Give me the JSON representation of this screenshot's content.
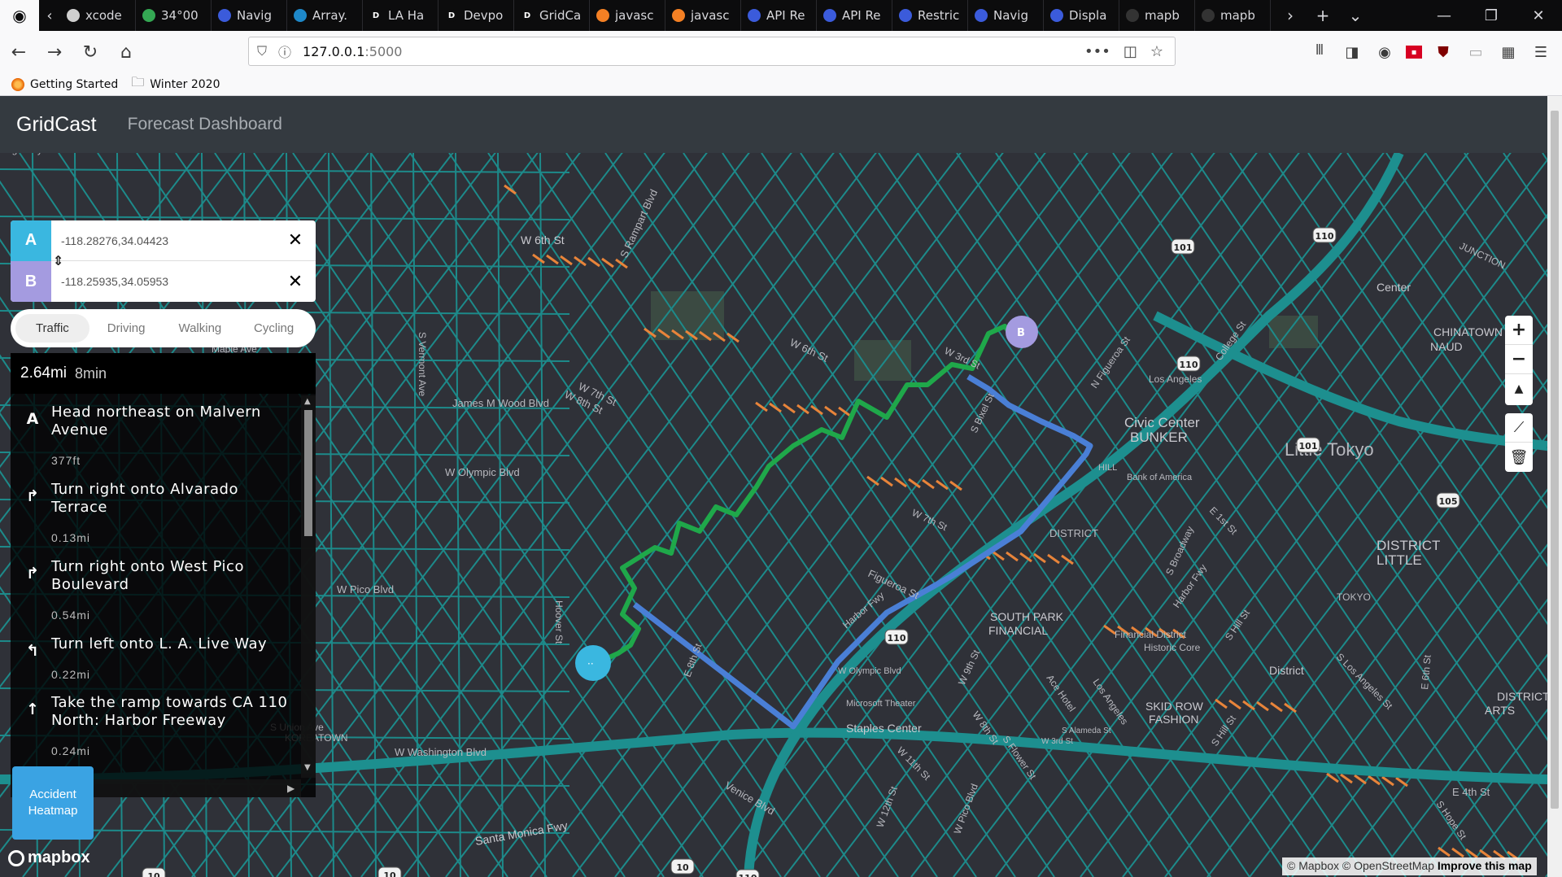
{
  "browser": {
    "tabs": [
      {
        "label": "xcode",
        "color": "#cfcfcf",
        "glyph": ""
      },
      {
        "label": "34°00",
        "color": "#34a853",
        "glyph": ""
      },
      {
        "label": "Navig",
        "color": "#3b5bdb",
        "glyph": ""
      },
      {
        "label": "Array.",
        "color": "#1e88c9",
        "glyph": ""
      },
      {
        "label": "LA Ha",
        "color": "#0c0c0d",
        "glyph": "D"
      },
      {
        "label": "Devpo",
        "color": "#0c0c0d",
        "glyph": "D"
      },
      {
        "label": "GridCa",
        "color": "#0c0c0d",
        "glyph": "D"
      },
      {
        "label": "javasc",
        "color": "#f48024",
        "glyph": ""
      },
      {
        "label": "javasc",
        "color": "#f48024",
        "glyph": ""
      },
      {
        "label": "API Re",
        "color": "#3b5bdb",
        "glyph": ""
      },
      {
        "label": "API Re",
        "color": "#3b5bdb",
        "glyph": ""
      },
      {
        "label": "Restric",
        "color": "#3b5bdb",
        "glyph": ""
      },
      {
        "label": "Navig",
        "color": "#3b5bdb",
        "glyph": ""
      },
      {
        "label": "Displa",
        "color": "#3b5bdb",
        "glyph": ""
      },
      {
        "label": "mapb",
        "color": "#333",
        "glyph": ""
      },
      {
        "label": "mapb",
        "color": "#333",
        "glyph": ""
      }
    ],
    "url_host": "127.0.0.1",
    "url_port": ":5000",
    "bookmarks": [
      {
        "label": "Getting Started",
        "icon": "firefox-icon"
      },
      {
        "label": "Winter 2020",
        "icon": "folder-icon"
      }
    ]
  },
  "app": {
    "brand": "GridCast",
    "nav_link": "Forecast Dashboard"
  },
  "directions": {
    "origin_label": "A",
    "origin_value": "-118.28276,34.04423",
    "destination_label": "B",
    "destination_value": "-118.25935,34.05953",
    "profiles": [
      "Traffic",
      "Driving",
      "Walking",
      "Cycling"
    ],
    "active_profile": "Traffic",
    "summary_distance": "2.64mi",
    "summary_duration": "8min",
    "steps": [
      {
        "icon": "A",
        "text": "Head northeast on Malvern Avenue",
        "distance": "377ft"
      },
      {
        "icon": "↱",
        "text": "Turn right onto Alvarado Terrace",
        "distance": "0.13mi"
      },
      {
        "icon": "↱",
        "text": "Turn right onto West Pico Boulevard",
        "distance": "0.54mi"
      },
      {
        "icon": "↰",
        "text": "Turn left onto L. A. Live Way",
        "distance": "0.22mi"
      },
      {
        "icon": "↑",
        "text": "Take the ramp towards CA 110 North: Harbor Freeway",
        "distance": "0.24mi"
      }
    ]
  },
  "map": {
    "labels": [
      {
        "text": "W 6th St"
      },
      {
        "text": "S Rampart Blvd"
      },
      {
        "text": "W 3rd St"
      },
      {
        "text": "W 6th St"
      },
      {
        "text": "W 7th St"
      },
      {
        "text": "W 8th St"
      },
      {
        "text": "James M Wood Blvd"
      },
      {
        "text": "W Olympic Blvd"
      },
      {
        "text": "W Pico Blvd"
      },
      {
        "text": "W Washington Blvd"
      },
      {
        "text": "Santa Monica Fwy"
      },
      {
        "text": "Venice Blvd"
      },
      {
        "text": "S Vermont Ave"
      },
      {
        "text": "Hoover St"
      },
      {
        "text": "S Bixel St"
      },
      {
        "text": "W 7th St"
      },
      {
        "text": "Harbor Fwy"
      },
      {
        "text": "Figueroa St"
      },
      {
        "text": "W Olympic Blvd"
      },
      {
        "text": "Microsoft Theater"
      },
      {
        "text": "Staples Center"
      },
      {
        "text": "SOUTH PARK"
      },
      {
        "text": "FINANCIAL"
      },
      {
        "text": "DISTRICT"
      },
      {
        "text": "Financial District"
      },
      {
        "text": "Historic Core"
      },
      {
        "text": "District"
      },
      {
        "text": "SKID ROW"
      },
      {
        "text": "FASHION"
      },
      {
        "text": "DISTRICT"
      },
      {
        "text": "ARTS"
      },
      {
        "text": "DISTRICT"
      },
      {
        "text": "LITTLE"
      },
      {
        "text": "TOKYO"
      },
      {
        "text": "Little Tokyo"
      },
      {
        "text": "Los Angeles"
      },
      {
        "text": "Civic Center"
      },
      {
        "text": "BUNKER"
      },
      {
        "text": "HILL"
      },
      {
        "text": "Bank of America"
      },
      {
        "text": "Center"
      },
      {
        "text": "CHINATOWN"
      },
      {
        "text": "NAUD"
      },
      {
        "text": "JUNCTION"
      },
      {
        "text": "College St"
      },
      {
        "text": "N Figueroa St"
      },
      {
        "text": "Harbor Fwy"
      },
      {
        "text": "S Broadway"
      },
      {
        "text": "S Hill St"
      },
      {
        "text": "S Los Angeles St"
      },
      {
        "text": "E 4th St"
      },
      {
        "text": "E 6th St"
      },
      {
        "text": "E 6th St"
      },
      {
        "text": "E 1st St"
      },
      {
        "text": "S Alameda St"
      },
      {
        "text": "W 3rd St"
      },
      {
        "text": "Ace Hotel"
      },
      {
        "text": "Los Angeles"
      },
      {
        "text": "W 9th St"
      },
      {
        "text": "W 8th St"
      },
      {
        "text": "S Flower St"
      },
      {
        "text": "W 11th St"
      },
      {
        "text": "W 12th St"
      },
      {
        "text": "W Pico Blvd"
      },
      {
        "text": "S Hope St"
      },
      {
        "text": "S Hill St"
      },
      {
        "text": "E 8th St"
      },
      {
        "text": "Maple Ave"
      },
      {
        "text": "S Union Ave"
      },
      {
        "text": "KOREATOWN"
      },
      {
        "text": "Angelus Rosedale"
      },
      {
        "text": "Cemetery"
      }
    ],
    "shields": [
      "101",
      "110",
      "110",
      "101",
      "110",
      "110",
      "10",
      "10",
      "10",
      "105"
    ],
    "marker_b": "B",
    "colors": {
      "route_walk": "#1fa84a",
      "route_drive": "#4a7fd6",
      "road": "#1d8a8a",
      "congested": "#e8843a",
      "origin": "#3ab7e0",
      "dest": "#a49be0"
    }
  },
  "controls": {
    "zoom_in": "+",
    "zoom_out": "−",
    "compass": "▲",
    "draw_line_icon": "line-icon",
    "trash_icon": "trash-icon"
  },
  "heatmap_button": "Accident Heatmap",
  "mapbox_logo": "mapbox",
  "attribution": {
    "mapbox": "© Mapbox",
    "osm": "© OpenStreetMap",
    "improve": "Improve this map"
  }
}
